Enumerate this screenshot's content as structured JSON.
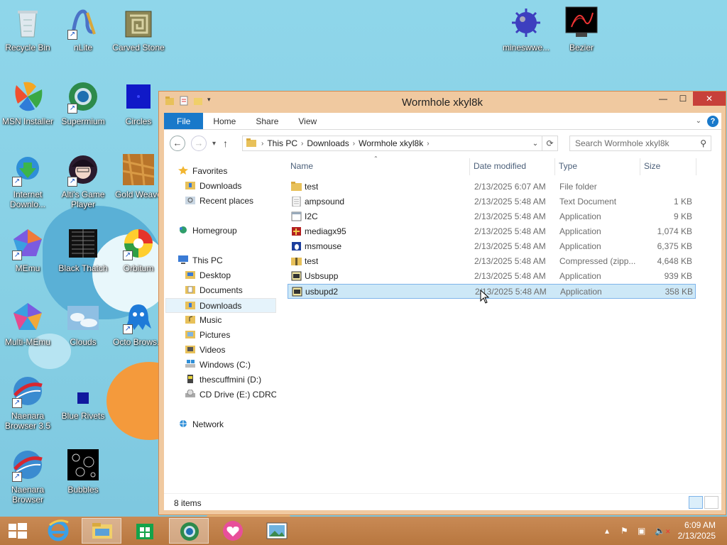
{
  "desktop": {
    "icons": [
      {
        "label": "Recycle Bin",
        "icon": "recycle-bin-icon"
      },
      {
        "label": "nLite",
        "icon": "nlite-icon"
      },
      {
        "label": "Carved Stone",
        "icon": "carved-stone-icon"
      },
      {
        "label": "mineswwe...",
        "icon": "mine-icon"
      },
      {
        "label": "Bezier",
        "icon": "bezier-icon"
      },
      {
        "label": "MSN Installer",
        "icon": "msn-icon"
      },
      {
        "label": "Supermium",
        "icon": "supermium-icon"
      },
      {
        "label": "Circles",
        "icon": "circles-icon"
      },
      {
        "label": "Internet Downlo...",
        "icon": "idm-icon"
      },
      {
        "label": "Alti's Game Player",
        "icon": "game-player-icon"
      },
      {
        "label": "Gold Weave",
        "icon": "gold-weave-icon"
      },
      {
        "label": "MEmu",
        "icon": "memu-icon"
      },
      {
        "label": "Black Thatch",
        "icon": "black-thatch-icon"
      },
      {
        "label": "Orbitum",
        "icon": "orbitum-icon"
      },
      {
        "label": "Multi-MEmu",
        "icon": "multi-memu-icon"
      },
      {
        "label": "Clouds",
        "icon": "clouds-icon"
      },
      {
        "label": "Octo Brows...",
        "icon": "octo-browser-icon"
      },
      {
        "label": "Naenara Browser 3.5",
        "icon": "naenara-icon"
      },
      {
        "label": "Blue Rivets",
        "icon": "blue-rivets-icon"
      },
      {
        "label": "Naenara Browser",
        "icon": "naenara-icon"
      },
      {
        "label": "Bubbles",
        "icon": "bubbles-icon"
      }
    ]
  },
  "window": {
    "title": "Wormhole xkyl8k",
    "controls": {
      "minimize": "—",
      "maximize": "☐",
      "close": "✕"
    }
  },
  "ribbon": {
    "tabs": [
      "File",
      "Home",
      "Share",
      "View"
    ],
    "help": "?"
  },
  "address": {
    "crumbs": [
      "This PC",
      "Downloads",
      "Wormhole xkyl8k"
    ],
    "search_placeholder": "Search Wormhole xkyl8k"
  },
  "nav": {
    "favorites": "Favorites",
    "downloads": "Downloads",
    "recent": "Recent places",
    "homegroup": "Homegroup",
    "thispc": "This PC",
    "desktop": "Desktop",
    "documents": "Documents",
    "downloads2": "Downloads",
    "music": "Music",
    "pictures": "Pictures",
    "videos": "Videos",
    "drive_c": "Windows (C:)",
    "drive_d": "thescuffmini (D:)",
    "drive_e": "CD Drive (E:) CDROM",
    "network": "Network"
  },
  "columns": {
    "name": "Name",
    "date": "Date modified",
    "type": "Type",
    "size": "Size"
  },
  "files": [
    {
      "name": "test",
      "date": "2/13/2025 6:07 AM",
      "type": "File folder",
      "size": "",
      "icon": "folder-icon"
    },
    {
      "name": "ampsound",
      "date": "2/13/2025 5:48 AM",
      "type": "Text Document",
      "size": "1 KB",
      "icon": "text-file-icon"
    },
    {
      "name": "I2C",
      "date": "2/13/2025 5:48 AM",
      "type": "Application",
      "size": "9 KB",
      "icon": "app-icon"
    },
    {
      "name": "mediagx95",
      "date": "2/13/2025 5:48 AM",
      "type": "Application",
      "size": "1,074 KB",
      "icon": "mediagx-icon"
    },
    {
      "name": "msmouse",
      "date": "2/13/2025 5:48 AM",
      "type": "Application",
      "size": "6,375 KB",
      "icon": "msmouse-icon"
    },
    {
      "name": "test",
      "date": "2/13/2025 5:48 AM",
      "type": "Compressed (zipp...",
      "size": "4,648 KB",
      "icon": "zip-folder-icon"
    },
    {
      "name": "Usbsupp",
      "date": "2/13/2025 5:48 AM",
      "type": "Application",
      "size": "939 KB",
      "icon": "installer-icon"
    },
    {
      "name": "usbupd2",
      "date": "2/13/2025 5:48 AM",
      "type": "Application",
      "size": "358 KB",
      "icon": "installer-icon"
    }
  ],
  "status": {
    "count": "8 items"
  },
  "taskbar": {
    "time": "6:09 AM",
    "date": "2/13/2025"
  }
}
